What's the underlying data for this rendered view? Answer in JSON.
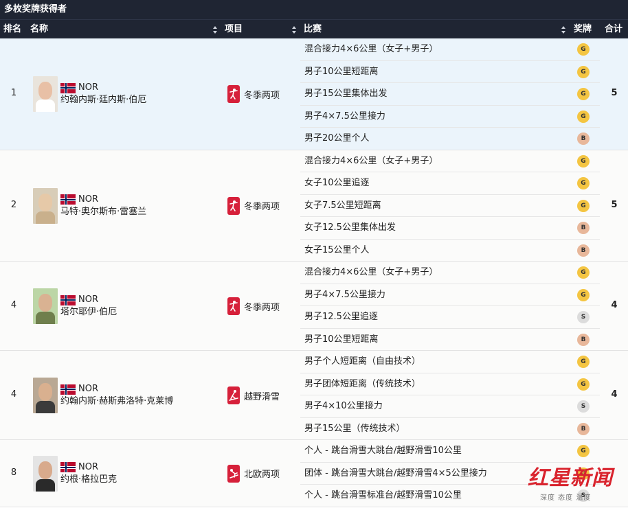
{
  "title": "多枚奖牌获得者",
  "columns": {
    "rank": "排名",
    "name": "名称",
    "sport": "项目",
    "event": "比赛",
    "medal": "奖牌",
    "total": "合计"
  },
  "rows": [
    {
      "rank": "1",
      "noc": "NOR",
      "name": "约翰内斯·廷内斯·伯厄",
      "sport": "冬季两项",
      "sport_icon": "biathlon-icon",
      "total": "5",
      "highlight": true,
      "events": [
        {
          "name": "混合接力4×6公里（女子+男子）",
          "medal": "G"
        },
        {
          "name": "男子10公里短距离",
          "medal": "G"
        },
        {
          "name": "男子15公里集体出发",
          "medal": "G"
        },
        {
          "name": "男子4×7.5公里接力",
          "medal": "G"
        },
        {
          "name": "男子20公里个人",
          "medal": "B"
        }
      ]
    },
    {
      "rank": "2",
      "noc": "NOR",
      "name": "马特·奥尔斯布·雷塞兰",
      "sport": "冬季两项",
      "sport_icon": "biathlon-icon",
      "total": "5",
      "highlight": false,
      "events": [
        {
          "name": "混合接力4×6公里（女子+男子）",
          "medal": "G"
        },
        {
          "name": "女子10公里追逐",
          "medal": "G"
        },
        {
          "name": "女子7.5公里短距离",
          "medal": "G"
        },
        {
          "name": "女子12.5公里集体出发",
          "medal": "B"
        },
        {
          "name": "女子15公里个人",
          "medal": "B"
        }
      ]
    },
    {
      "rank": "4",
      "noc": "NOR",
      "name": "塔尔耶伊·伯厄",
      "sport": "冬季两项",
      "sport_icon": "biathlon-icon",
      "total": "4",
      "highlight": false,
      "events": [
        {
          "name": "混合接力4×6公里（女子+男子）",
          "medal": "G"
        },
        {
          "name": "男子4×7.5公里接力",
          "medal": "G"
        },
        {
          "name": "男子12.5公里追逐",
          "medal": "S"
        },
        {
          "name": "男子10公里短距离",
          "medal": "B"
        }
      ]
    },
    {
      "rank": "4",
      "noc": "NOR",
      "name": "约翰内斯·赫斯弗洛特·克莱博",
      "sport": "越野滑雪",
      "sport_icon": "cross-country-skiing-icon",
      "total": "4",
      "highlight": false,
      "events": [
        {
          "name": "男子个人短距离（自由技术）",
          "medal": "G"
        },
        {
          "name": "男子团体短距离（传统技术）",
          "medal": "G"
        },
        {
          "name": "男子4×10公里接力",
          "medal": "S"
        },
        {
          "name": "男子15公里（传统技术）",
          "medal": "B"
        }
      ]
    },
    {
      "rank": "8",
      "noc": "NOR",
      "name": "约根·格拉巴克",
      "sport": "北欧两项",
      "sport_icon": "nordic-combined-icon",
      "total": "",
      "highlight": false,
      "events": [
        {
          "name": "个人 - 跳台滑雪大跳台/越野滑雪10公里",
          "medal": "G"
        },
        {
          "name": "团体 - 跳台滑雪大跳台/越野滑雪4×5公里接力",
          "medal": "G"
        },
        {
          "name": "个人 - 跳台滑雪标准台/越野滑雪10公里",
          "medal": "S"
        }
      ]
    }
  ],
  "watermark": {
    "brand": "红星新闻",
    "tagline": "深度 态度 温度"
  }
}
